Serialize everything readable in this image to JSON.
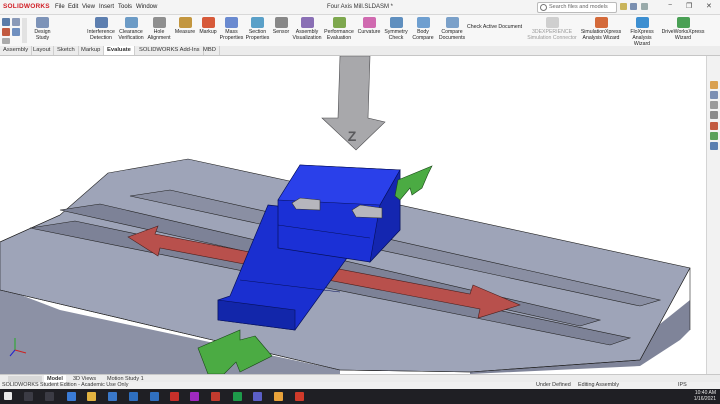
{
  "app": {
    "logo_prefix": "3S",
    "logo": "SOLIDWORKS",
    "title": "Four Axis Mill.SLDASM *"
  },
  "menu": [
    "File",
    "Edit",
    "View",
    "Insert",
    "Tools",
    "Window"
  ],
  "search": {
    "placeholder": "Search files and models"
  },
  "ribbon": [
    {
      "label": "Design Study",
      "color": "#7d93b8"
    },
    {
      "label": "Interference Detection",
      "color": "#5d7fb0"
    },
    {
      "label": "Clearance Verification",
      "color": "#6c9bc6"
    },
    {
      "label": "Hole Alignment",
      "color": "#8f8f8f"
    },
    {
      "label": "Measure",
      "color": "#c3963f"
    },
    {
      "label": "Markup",
      "color": "#d75a3a"
    },
    {
      "label": "Mass Properties",
      "color": "#6a8ad0"
    },
    {
      "label": "Section Properties",
      "color": "#5aa0c8"
    },
    {
      "label": "Sensor",
      "color": "#888"
    },
    {
      "label": "Assembly Visualization",
      "color": "#8a6fb5"
    },
    {
      "label": "Performance Evaluation",
      "color": "#7ea84e"
    },
    {
      "label": "Curvature",
      "color": "#d06ab0"
    },
    {
      "label": "Symmetry Check",
      "color": "#5f8fbf"
    },
    {
      "label": "Body Compare",
      "color": "#6f9fd0"
    },
    {
      "label": "Compare Documents",
      "color": "#7aa0c9"
    },
    {
      "label": "Check Active Document",
      "color": "#7c92b5"
    },
    {
      "label": "3DEXPERIENCE Simulation Connector",
      "color": "#bcbcbc"
    },
    {
      "label": "SimulationXpress Analysis Wizard",
      "color": "#d46a3a"
    },
    {
      "label": "FloXpress Analysis Wizard",
      "color": "#3d8fd1"
    },
    {
      "label": "DriveWorksXpress Wizard",
      "color": "#4aa055"
    }
  ],
  "tabs": [
    "Assembly",
    "Layout",
    "Sketch",
    "Markup",
    "Evaluate",
    "SOLIDWORKS Add-Ins",
    "MBD"
  ],
  "active_tab": "Evaluate",
  "model": {
    "z_label": "Z",
    "colors": {
      "table_top": "#9da3b8",
      "table_side": "#8a8fa3",
      "slot": "#7d8297",
      "blue": "#1a2fd0",
      "red": "#b8504c",
      "green": "#4bab43",
      "gray_arrow": "#a8a8ab"
    }
  },
  "bottom_tabs": [
    "Model",
    "3D Views",
    "Motion Study 1"
  ],
  "active_bottom_tab": "Model",
  "status": {
    "left": "SOLIDWORKS Student Edition - Academic Use Only",
    "underdefined": "Under Defined",
    "editing": "Editing Assembly",
    "units": "IPS"
  },
  "clock": {
    "time": "10:40 AM",
    "date": "1/16/2021"
  }
}
